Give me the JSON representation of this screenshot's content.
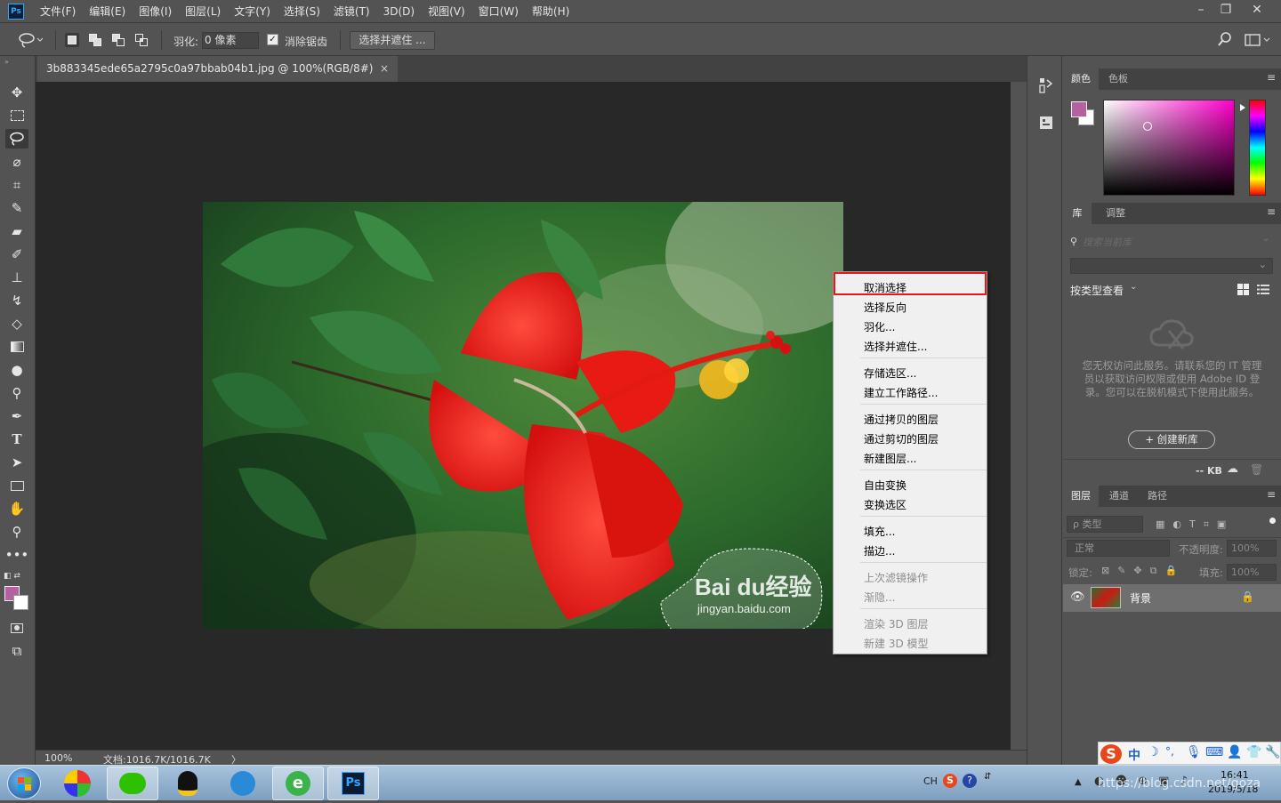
{
  "menubar": {
    "app_icon": "Ps",
    "items": [
      "文件(F)",
      "编辑(E)",
      "图像(I)",
      "图层(L)",
      "文字(Y)",
      "选择(S)",
      "滤镜(T)",
      "3D(D)",
      "视图(V)",
      "窗口(W)",
      "帮助(H)"
    ],
    "window_controls": [
      "minimize-icon",
      "restore-icon",
      "close-icon"
    ]
  },
  "options_bar": {
    "feather_label": "羽化:",
    "feather_value": "0 像素",
    "antialias_label": "消除锯齿",
    "antialias_checked": true,
    "select_and_mask": "选择并遮住 ..."
  },
  "document": {
    "tab_title": "3b883345ede65a2795c0a97bbab04b1.jpg @ 100%(RGB/8#)",
    "tab_close": "×",
    "watermark_brand": "Bai du经验",
    "watermark_url": "jingyan.baidu.com"
  },
  "status_bar": {
    "zoom": "100%",
    "doc_size": "文档:1016.7K/1016.7K",
    "arrow": "〉"
  },
  "context_menu": {
    "groups": [
      [
        {
          "label": "取消选择",
          "enabled": true,
          "highlighted": true
        },
        {
          "label": "选择反向",
          "enabled": true
        },
        {
          "label": "羽化...",
          "enabled": true
        },
        {
          "label": "选择并遮住...",
          "enabled": true
        }
      ],
      [
        {
          "label": "存储选区...",
          "enabled": true
        },
        {
          "label": "建立工作路径...",
          "enabled": true
        }
      ],
      [
        {
          "label": "通过拷贝的图层",
          "enabled": true
        },
        {
          "label": "通过剪切的图层",
          "enabled": true
        },
        {
          "label": "新建图层...",
          "enabled": true
        }
      ],
      [
        {
          "label": "自由变换",
          "enabled": true
        },
        {
          "label": "变换选区",
          "enabled": true
        }
      ],
      [
        {
          "label": "填充...",
          "enabled": true
        },
        {
          "label": "描边...",
          "enabled": true
        }
      ],
      [
        {
          "label": "上次滤镜操作",
          "enabled": false
        },
        {
          "label": "渐隐...",
          "enabled": false
        }
      ],
      [
        {
          "label": "渲染 3D 图层",
          "enabled": false
        },
        {
          "label": "新建 3D 模型",
          "enabled": false
        }
      ]
    ]
  },
  "color_panel": {
    "tabs": [
      "颜色",
      "色板"
    ],
    "foreground": "#b5609f",
    "background": "#ffffff"
  },
  "library_panel": {
    "tabs": [
      "库",
      "调整"
    ],
    "search_placeholder": "搜索当前库",
    "view_label": "按类型查看",
    "message": "您无权访问此服务。请联系您的 IT 管理员以获取访问权限或使用 Adobe ID 登录。您可以在脱机模式下使用此服务。",
    "create_button": "+ 创建新库",
    "kb_label": "-- KB"
  },
  "layers_panel": {
    "tabs": [
      "图层",
      "通道",
      "路径"
    ],
    "filter_label": "ρ 类型",
    "blend_mode": "正常",
    "opacity_label": "不透明度:",
    "opacity_value": "100%",
    "lock_label": "锁定:",
    "fill_label": "填充:",
    "fill_value": "100%",
    "layers": [
      {
        "name": "背景",
        "visible": true,
        "locked": true
      }
    ]
  },
  "ime_toolbar": {
    "items": [
      "中",
      "☽",
      "°,",
      "mic-icon",
      "keyboard-icon",
      "user-icon",
      "shirt-icon",
      "wrench-icon"
    ]
  },
  "taskbar": {
    "apps": [
      "start-orb",
      "browser-icon",
      "wechat-icon",
      "qq-icon",
      "feather-icon",
      "ie-icon",
      "photoshop-icon"
    ],
    "tray_lang": "CH",
    "time": "16:41",
    "date": "2019/5/18",
    "overlay_text": "https://blog.csdn.net/goza"
  }
}
